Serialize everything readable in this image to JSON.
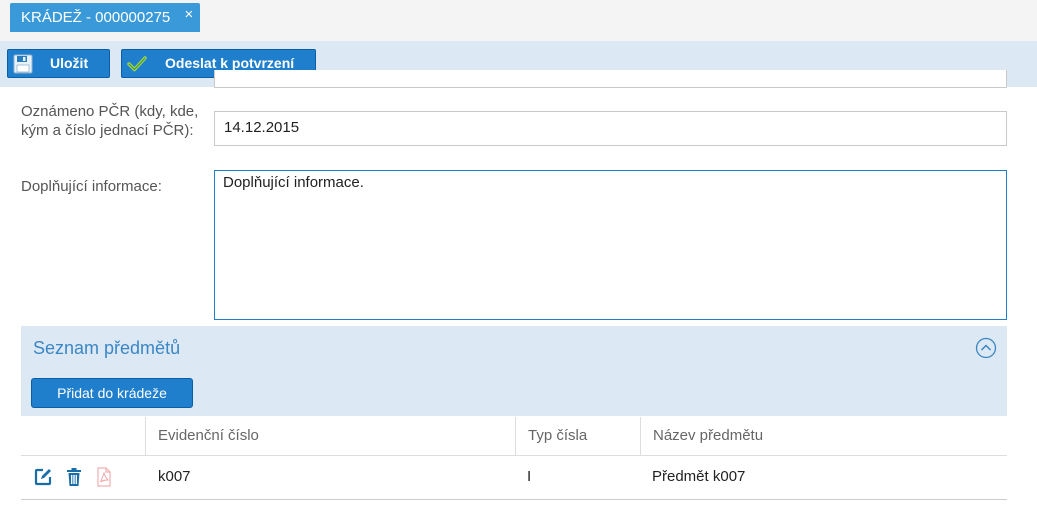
{
  "tab": {
    "title": "KRÁDEŽ - 000000275",
    "close_glyph": "×"
  },
  "toolbar": {
    "save_label": "Uložit",
    "send_label": "Odeslat k potvrzení"
  },
  "form": {
    "reported_label": "Oznámeno PČR (kdy, kde, kým a číslo jednací PČR):",
    "reported_value": "14.12.2015",
    "additional_label": "Doplňující informace:",
    "additional_value": "Doplňující informace."
  },
  "items_section": {
    "title": "Seznam předmětů",
    "add_label": "Přidat do krádeže",
    "columns": [
      "Evidenční číslo",
      "Typ čísla",
      "Název předmětu"
    ],
    "rows": [
      {
        "evidencni_cislo": "k007",
        "typ_cisla": "I",
        "nazev_predmetu": "Předmět k007"
      }
    ]
  },
  "icons": {
    "save": "floppy-disk-icon",
    "send": "check-icon",
    "collapse": "chevron-up-circle-icon",
    "edit": "edit-icon",
    "delete": "trash-icon",
    "pdf": "pdf-icon"
  },
  "colors": {
    "accent": "#1f7fcc",
    "tab": "#3a9ad9",
    "toolbar_bg": "#dde8f5",
    "section_title": "#3a87c4"
  }
}
